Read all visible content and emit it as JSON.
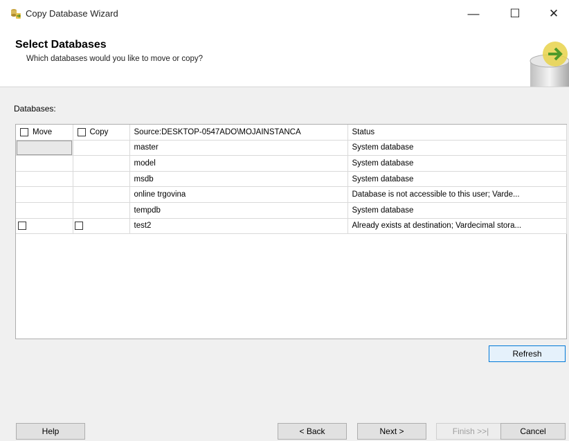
{
  "window": {
    "title": "Copy Database Wizard",
    "controls": {
      "minimize": "—",
      "maximize": "☐",
      "close": "✕"
    },
    "app_icon": "database-wizard-icon"
  },
  "header": {
    "title": "Select Databases",
    "subtitle": "Which databases would you like to move or copy?"
  },
  "databases_label": "Databases:",
  "grid": {
    "columns": {
      "move": "Move",
      "copy": "Copy",
      "source": "Source:DESKTOP-0547ADO\\MOJAINSTANCA",
      "status": "Status"
    },
    "rows": [
      {
        "name": "master",
        "status": "System database",
        "has_checkboxes": false
      },
      {
        "name": "model",
        "status": "System database",
        "has_checkboxes": false
      },
      {
        "name": "msdb",
        "status": "System database",
        "has_checkboxes": false
      },
      {
        "name": "online trgovina",
        "status": "Database is not accessible to this user; Varde...",
        "has_checkboxes": false
      },
      {
        "name": "tempdb",
        "status": "System database",
        "has_checkboxes": false
      },
      {
        "name": "test2",
        "status": "Already exists at destination; Vardecimal stora...",
        "has_checkboxes": true
      }
    ]
  },
  "buttons": {
    "refresh": "Refresh",
    "help": "Help",
    "back": "< Back",
    "next": "Next >",
    "finish": "Finish >>|",
    "cancel": "Cancel"
  },
  "colors": {
    "accent": "#0078d7",
    "button_face": "#e1e1e1",
    "dialog_bg": "#f0f0f0"
  }
}
